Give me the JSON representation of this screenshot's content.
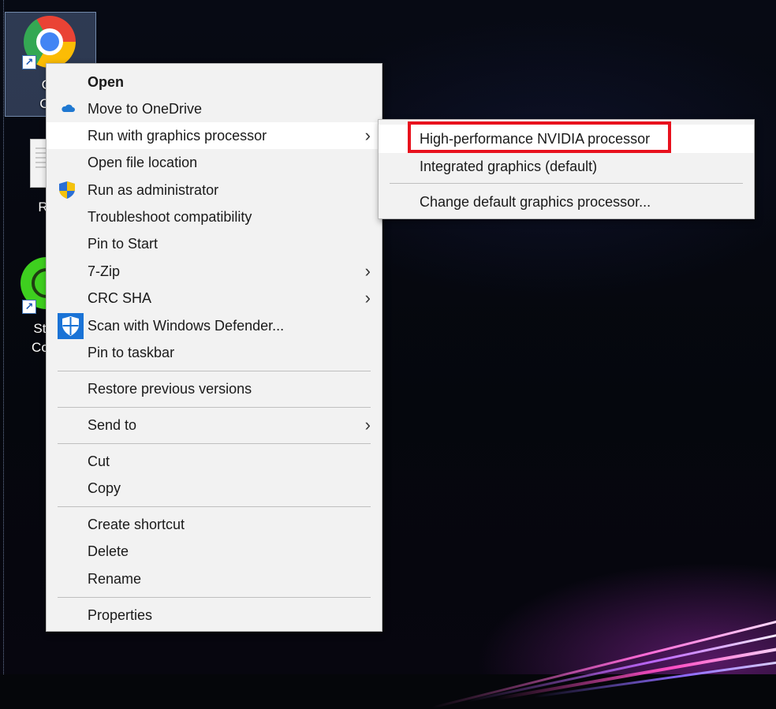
{
  "desktop": {
    "icons": [
      {
        "label_partial": [
          "Go",
          "Chr"
        ]
      },
      {
        "label_partial": [
          "Rea"
        ]
      },
      {
        "label_partial": [
          "Stre",
          "Com"
        ]
      }
    ]
  },
  "context_menu": {
    "items": [
      {
        "label": "Open",
        "bold": true
      },
      {
        "label": "Move to OneDrive",
        "icon": "onedrive-icon"
      },
      {
        "label": "Run with graphics processor",
        "submenu": true,
        "highlighted": true
      },
      {
        "label": "Open file location"
      },
      {
        "label": "Run as administrator",
        "icon": "uac-shield-icon"
      },
      {
        "label": "Troubleshoot compatibility"
      },
      {
        "label": "Pin to Start"
      },
      {
        "label": "7-Zip",
        "submenu": true
      },
      {
        "label": "CRC SHA",
        "submenu": true
      },
      {
        "label": "Scan with Windows Defender...",
        "icon": "windows-defender-icon"
      },
      {
        "label": "Pin to taskbar"
      },
      {
        "label": "Restore previous versions"
      },
      {
        "label": "Send to",
        "submenu": true
      },
      {
        "label": "Cut"
      },
      {
        "label": "Copy"
      },
      {
        "label": "Create shortcut"
      },
      {
        "label": "Delete"
      },
      {
        "label": "Rename"
      },
      {
        "label": "Properties"
      }
    ],
    "arrow_glyph": "›"
  },
  "graphics_submenu": {
    "items": [
      {
        "label": "High-performance NVIDIA processor",
        "highlighted": true,
        "annotated": true
      },
      {
        "label": "Integrated graphics (default)"
      },
      {
        "label": "Change default graphics processor..."
      }
    ]
  },
  "colors": {
    "menu_bg": "#f2f2f2",
    "highlight_bg": "#ffffff",
    "annotation_red": "#e8111d",
    "defender_blue": "#1a73d6"
  }
}
